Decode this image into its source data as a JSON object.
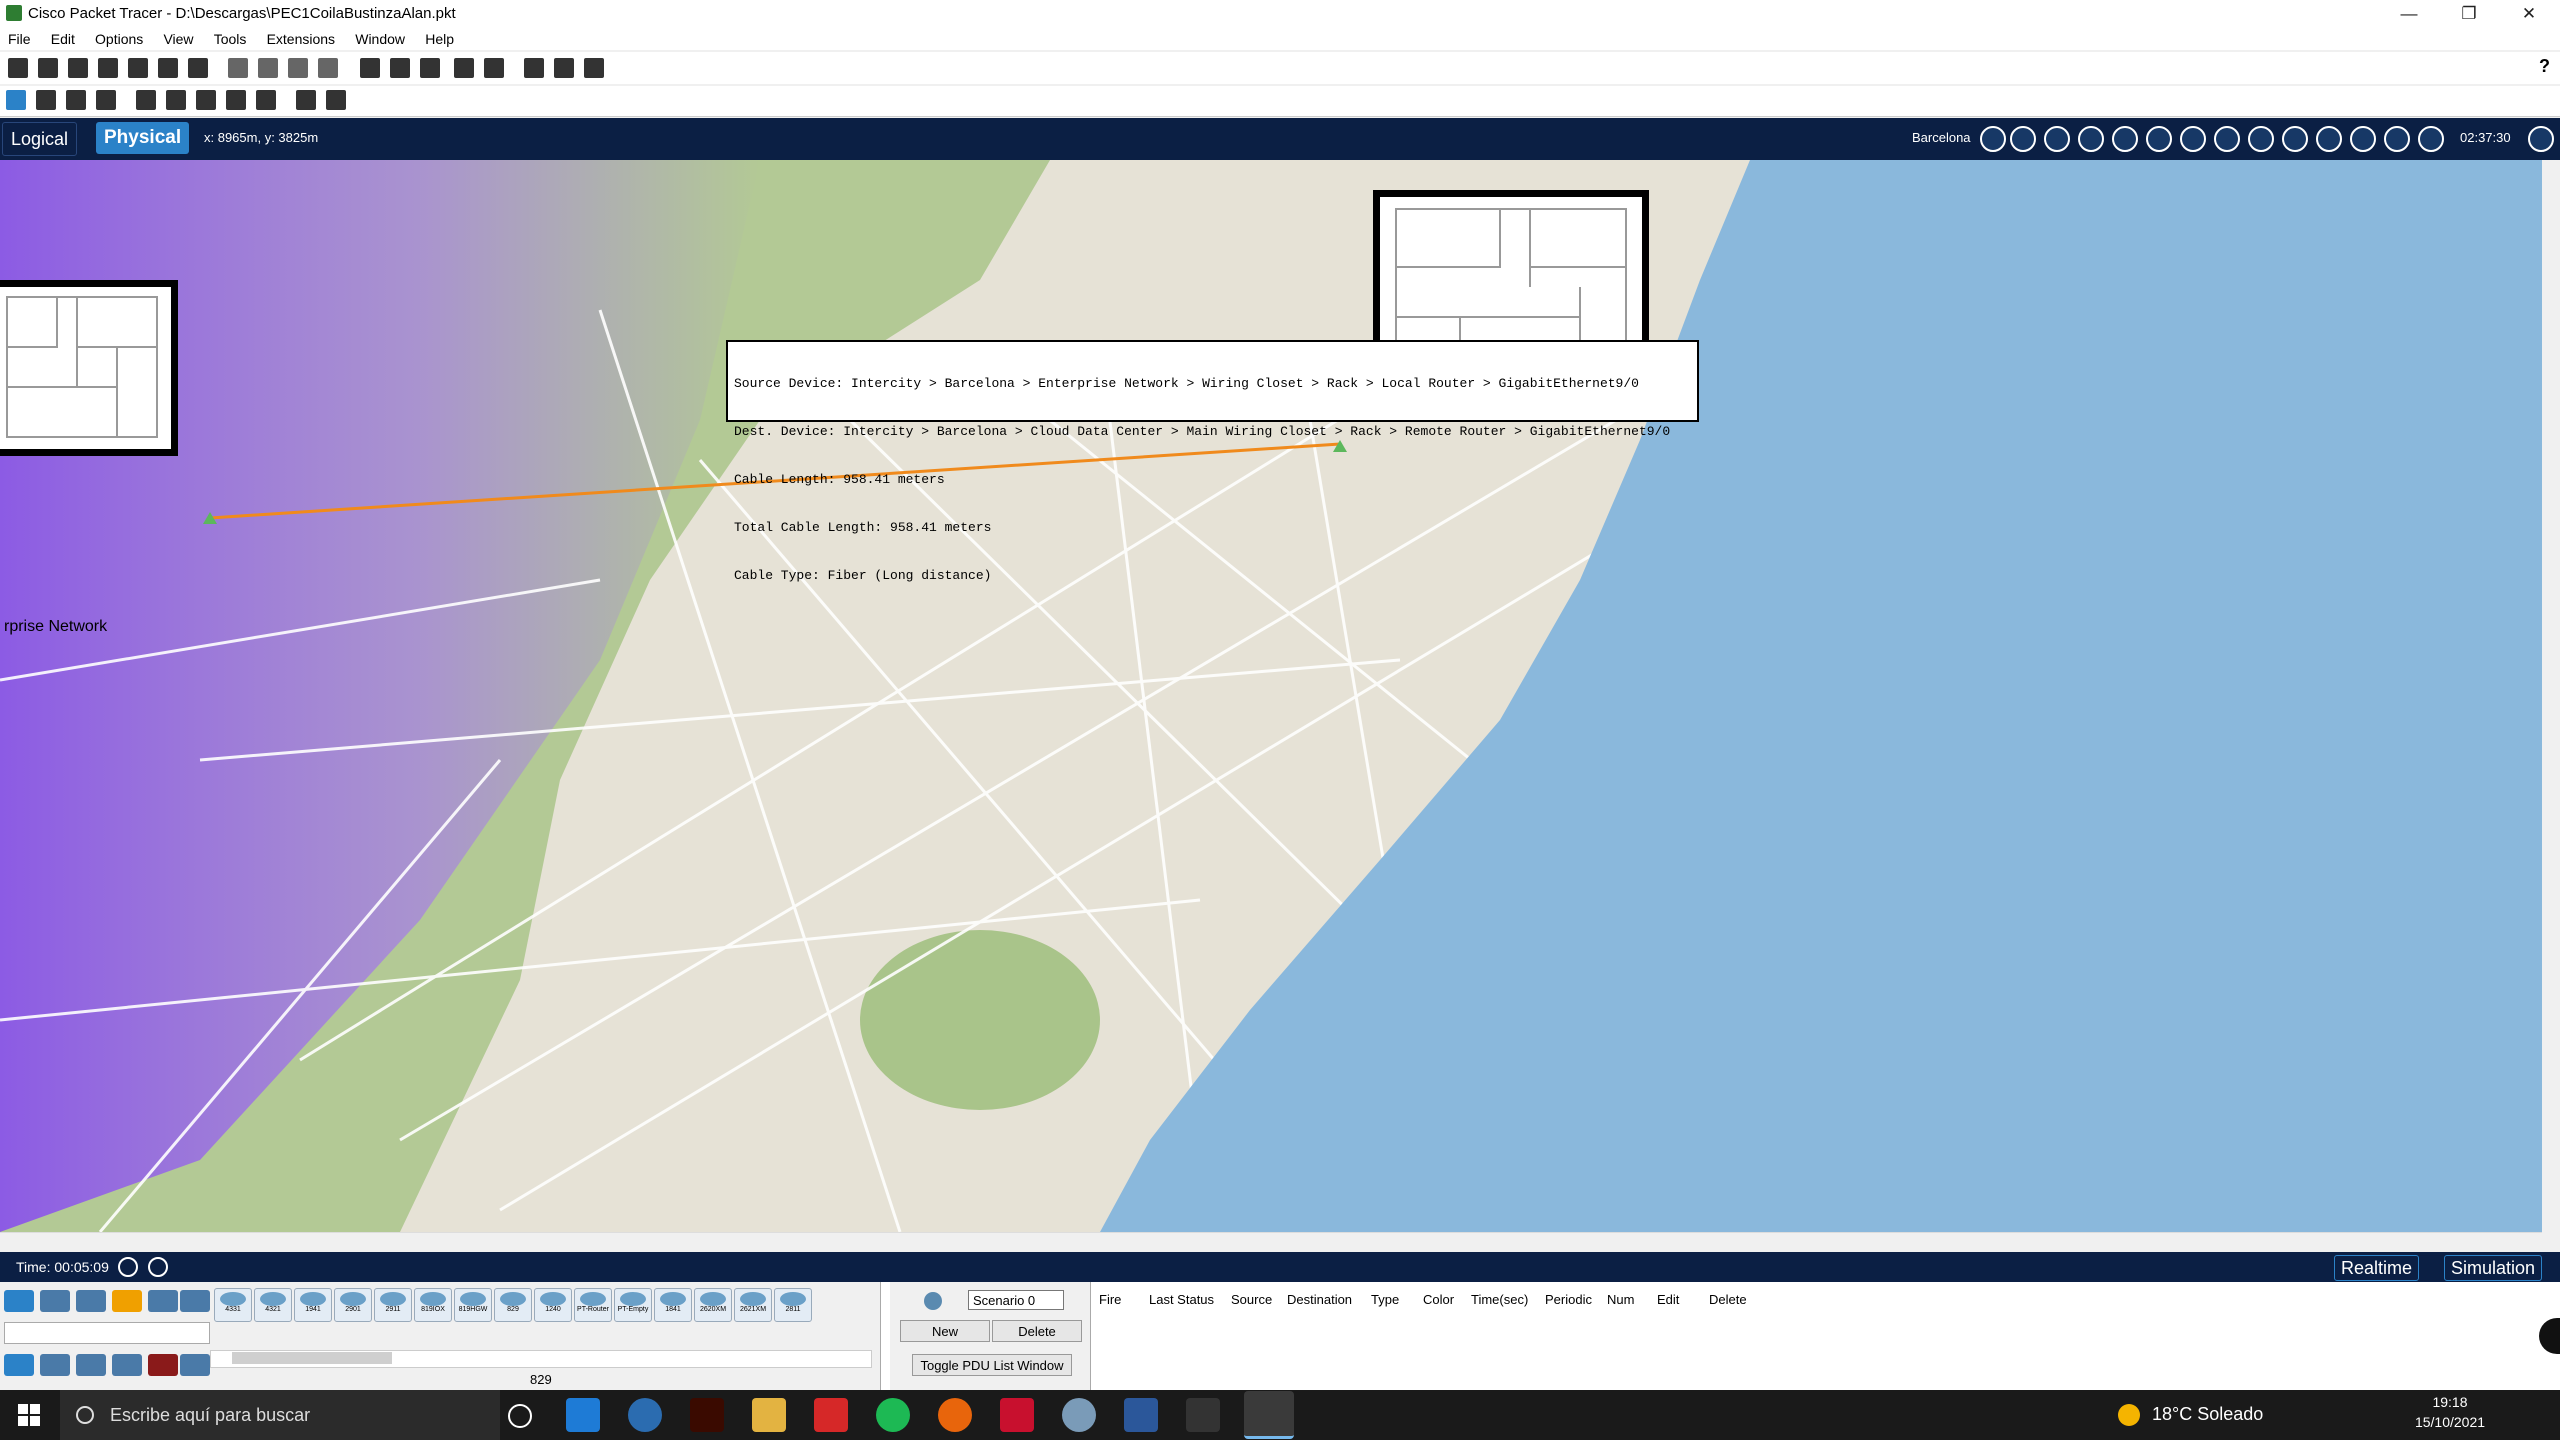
{
  "window": {
    "title": "Cisco Packet Tracer - D:\\Descargas\\PEC1CoilaBustinzaAlan.pkt",
    "minimize": "—",
    "restore": "❐",
    "close": "✕"
  },
  "menu": [
    "File",
    "Edit",
    "Options",
    "View",
    "Tools",
    "Extensions",
    "Window",
    "Help"
  ],
  "toolbar": {
    "help_label": "?"
  },
  "nav": {
    "logical_label": "Logical",
    "physical_label": "Physical",
    "coords": "x: 8965m, y: 3825m",
    "location": "Barcelona",
    "clock": "02:37:30"
  },
  "map": {
    "enterprise_label": "rprise Network",
    "tooltip": {
      "line1": "Source Device: Intercity > Barcelona > Enterprise Network > Wiring Closet > Rack > Local Router > GigabitEthernet9/0",
      "line2": "Dest. Device: Intercity > Barcelona > Cloud Data Center > Main Wiring Closet > Rack > Remote Router > GigabitEthernet9/0",
      "line3": "Cable Length: 958.41 meters",
      "line4": "Total Cable Length: 958.41 meters",
      "line5": "Cable Type: Fiber (Long distance)"
    },
    "cable_color": "#f08a1c",
    "sea_color": "#8ab8dc"
  },
  "simulation": {
    "time": "Time: 00:05:09",
    "realtime_label": "Realtime",
    "simulation_label": "Simulation"
  },
  "devices": {
    "models": [
      "4331",
      "4321",
      "1941",
      "2901",
      "2911",
      "819IOX",
      "819HGW",
      "829",
      "1240",
      "PT-Router",
      "PT-Empty",
      "1841",
      "2620XM",
      "2621XM",
      "2811"
    ],
    "selected": "829"
  },
  "scenario": {
    "selected": "Scenario 0",
    "new_label": "New",
    "delete_label": "Delete",
    "toggle_label": "Toggle PDU List Window"
  },
  "pdu_columns": [
    "Fire",
    "Last Status",
    "Source",
    "Destination",
    "Type",
    "Color",
    "Time(sec)",
    "Periodic",
    "Num",
    "Edit",
    "Delete"
  ],
  "taskbar": {
    "search_placeholder": "Escribe aquí para buscar",
    "weather": "18°C  Soleado",
    "time": "19:18",
    "date": "15/10/2021"
  }
}
